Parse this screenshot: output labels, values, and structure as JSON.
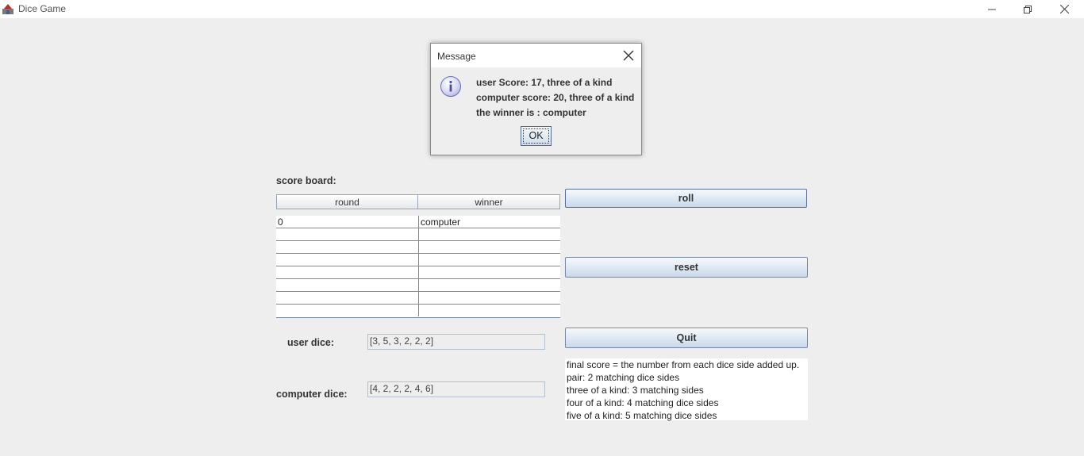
{
  "window": {
    "title": "Dice Game",
    "controls": {
      "minimize_icon": "minimize-icon",
      "maximize_icon": "restore-icon",
      "close_icon": "close-icon"
    }
  },
  "scoreboard": {
    "label": "score board:",
    "columns": [
      "round",
      "winner"
    ],
    "rows": [
      [
        "0",
        "computer"
      ],
      [
        "",
        ""
      ],
      [
        "",
        ""
      ],
      [
        "",
        ""
      ],
      [
        "",
        ""
      ],
      [
        "",
        ""
      ],
      [
        "",
        ""
      ],
      [
        "",
        ""
      ]
    ]
  },
  "buttons": {
    "roll": "roll",
    "reset": "reset",
    "quit": "Quit"
  },
  "dice": {
    "user_label": "user dice:",
    "user_value": "[3, 5, 3, 2, 2, 2]",
    "computer_label": "computer dice:",
    "computer_value": "[4, 2, 2, 2, 4, 6]"
  },
  "rules": [
    "final score = the number from each dice side added up.",
    "pair: 2 matching dice sides",
    "three of a kind: 3 matching sides",
    "four of a kind: 4 matching dice sides",
    "five of a kind: 5 matching dice sides"
  ],
  "dialog": {
    "title": "Message",
    "icon": "info-icon",
    "lines": [
      "user Score: 17, three of a kind",
      "computer score: 20, three of a kind",
      "the winner is : computer"
    ],
    "ok_label": "OK"
  },
  "colors": {
    "background": "#eeeeee",
    "button_border": "#7a8aa3",
    "table_grid": "#7a8a9f"
  }
}
